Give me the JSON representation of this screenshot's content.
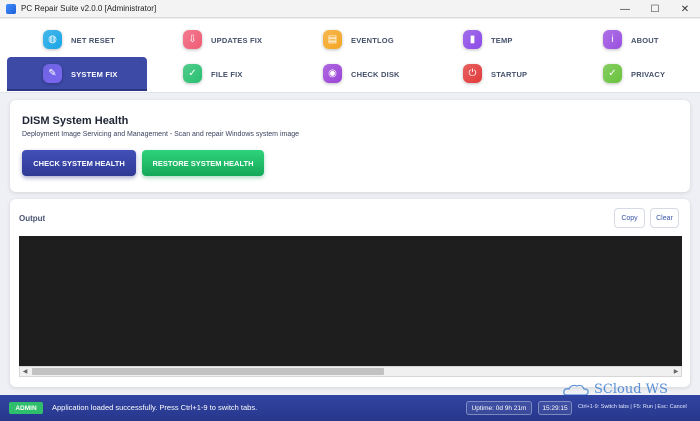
{
  "window": {
    "title": "PC Repair Suite v2.0.0 [Administrator]",
    "controls": {
      "minimize": "—",
      "maximize": "☐",
      "close": "✕"
    }
  },
  "tabs": [
    {
      "id": "net-reset",
      "label": "NET RESET",
      "icon": "globe-icon",
      "glyph": "◍",
      "color": "#18a5e6",
      "active": false
    },
    {
      "id": "updates-fix",
      "label": "UPDATES FIX",
      "icon": "download-icon",
      "glyph": "⇩",
      "color": "#ef5b74",
      "active": false
    },
    {
      "id": "eventlog",
      "label": "EVENTLOG",
      "icon": "document-icon",
      "glyph": "▤",
      "color": "#f4a623",
      "active": false
    },
    {
      "id": "temp",
      "label": "TEMP",
      "icon": "trash-icon",
      "glyph": "▮",
      "color": "#8b4ae6",
      "active": false
    },
    {
      "id": "about",
      "label": "ABOUT",
      "icon": "info-icon",
      "glyph": "i",
      "color": "#9a4fe0",
      "active": false
    },
    {
      "id": "system-fix",
      "label": "SYSTEM FIX",
      "icon": "wrench-icon",
      "glyph": "✎",
      "color": "#7a68f0",
      "active": true
    },
    {
      "id": "file-fix",
      "label": "FILE FIX",
      "icon": "file-check-icon",
      "glyph": "✓",
      "color": "#27c070",
      "active": false
    },
    {
      "id": "check-disk",
      "label": "CHECK DISK",
      "icon": "disk-icon",
      "glyph": "◉",
      "color": "#9b43d8",
      "active": false
    },
    {
      "id": "startup",
      "label": "STARTUP",
      "icon": "power-icon",
      "glyph": "⏻",
      "color": "#e23a3a",
      "active": false
    },
    {
      "id": "privacy",
      "label": "PRIVACY",
      "icon": "shield-icon",
      "glyph": "✓",
      "color": "#69c23c",
      "active": false
    }
  ],
  "dism": {
    "title": "DISM System Health",
    "subtitle": "Deployment Image Servicing and Management - Scan and repair Windows system image",
    "check_label": "CHECK SYSTEM HEALTH",
    "restore_label": "RESTORE SYSTEM HEALTH"
  },
  "output": {
    "title": "Output",
    "copy_label": "Copy",
    "clear_label": "Clear",
    "content": "",
    "scroll_left": "◀",
    "scroll_right": "▶"
  },
  "status": {
    "badge": "ADMIN",
    "message": "Application loaded successfully. Press Ctrl+1-9 to switch tabs.",
    "uptime": "Uptime: 0d 9h 21m",
    "clock": "15:29:15",
    "shortcuts": "Ctrl+1-9: Switch tabs | F5: Run | Esc: Cancel"
  },
  "watermark": {
    "text": "SCloud WS"
  },
  "colors": {
    "accent": "#3d4aa6",
    "success": "#22c06a",
    "terminal_bg": "#1e1e1e",
    "statusbar": "#2d3e9c"
  }
}
